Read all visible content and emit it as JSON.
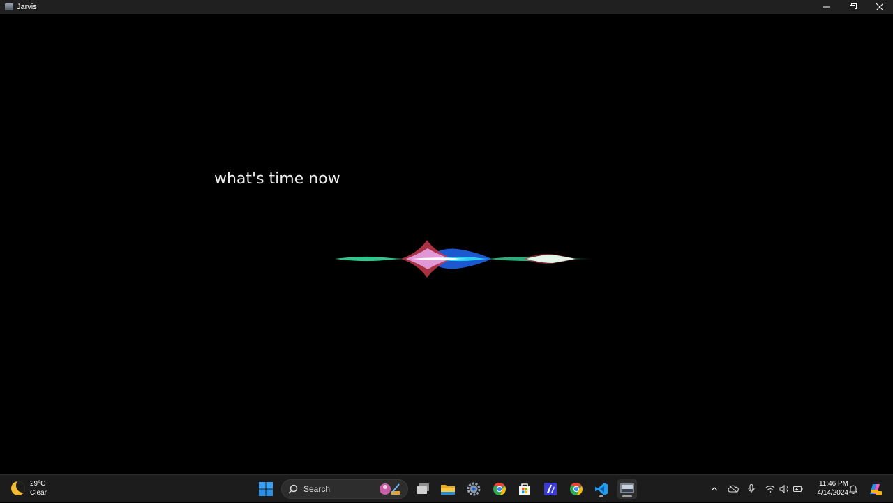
{
  "window": {
    "title": "Jarvis"
  },
  "assistant": {
    "transcript": "what's time now"
  },
  "taskbar": {
    "weather": {
      "temperature": "29°C",
      "condition": "Clear"
    },
    "search": {
      "label": "Search"
    },
    "clock": {
      "time": "11:46 PM",
      "date": "4/14/2024"
    },
    "pinned_apps": [
      "start-icon",
      "task-view-icon",
      "file-explorer-icon",
      "settings-icon",
      "chrome-icon",
      "microsoft-store-icon",
      "azure-data-studio-icon",
      "chrome-canary-icon",
      "vscode-icon",
      "jarvis-app-icon"
    ],
    "tray_icons": [
      "chevron-up-icon",
      "onedrive-icon",
      "microphone-icon",
      "wifi-icon",
      "speaker-icon",
      "battery-icon",
      "notification-bell-icon",
      "copilot-icon"
    ]
  },
  "colors": {
    "taskbar_bg": "#1c1c1c",
    "titlebar_bg": "#202020",
    "background": "#000000"
  }
}
